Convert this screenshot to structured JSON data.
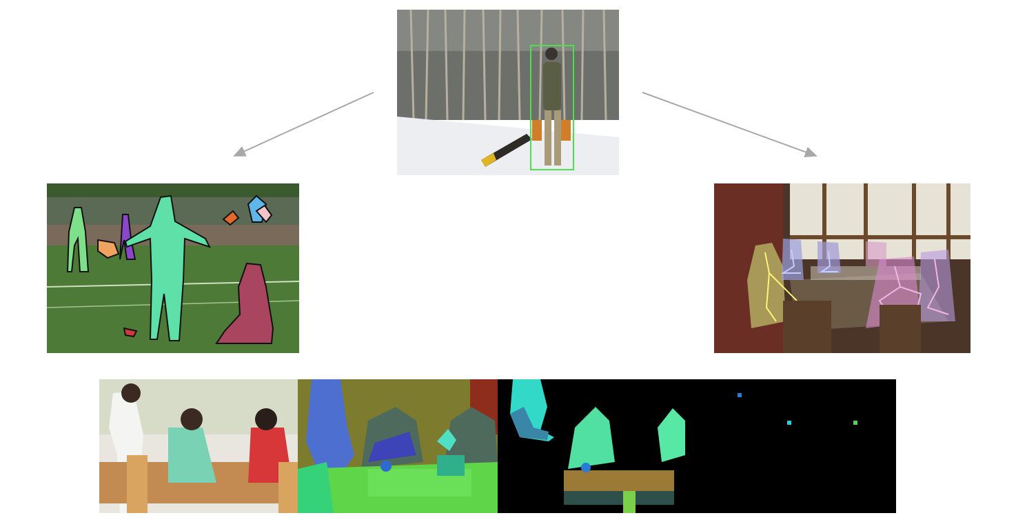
{
  "panels": {
    "center": {
      "description_hidden": ""
    },
    "left": {
      "description_hidden": ""
    },
    "right": {
      "description_hidden": ""
    },
    "bottom": {
      "description_hidden": ""
    }
  },
  "colors": {
    "arrow": "#a8a8a8",
    "bbox": "#4ce04c",
    "person_green": "#5ee0a8",
    "person_pink": "#a9455f",
    "person_purple": "#8a47c9",
    "seg_olive": "#7c7b2e",
    "seg_blue": "#4c6fd0",
    "seg_green": "#5fd64a",
    "seg_cyan": "#32d8c8",
    "seg_table": "#9b7a35",
    "background_black": "#000000"
  },
  "connectors": [
    {
      "from": "center-image",
      "to": "left-image"
    },
    {
      "from": "center-image",
      "to": "right-image"
    }
  ]
}
